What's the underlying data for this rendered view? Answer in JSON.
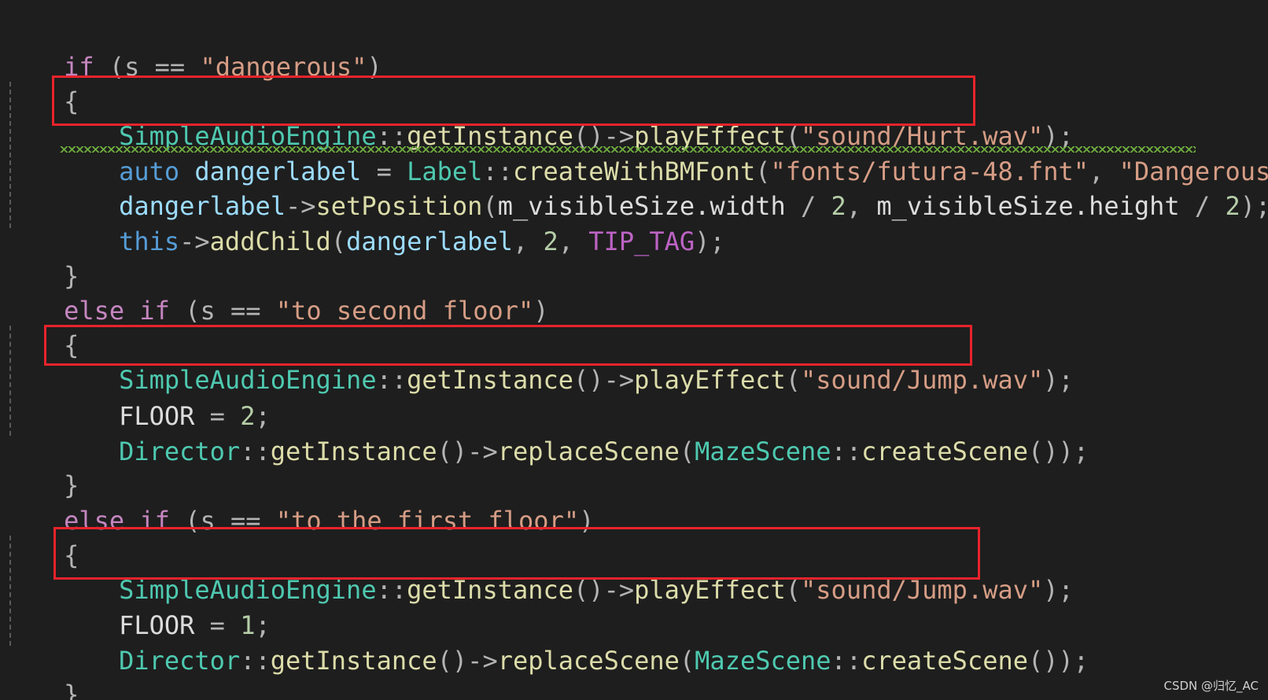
{
  "code": {
    "l1": {
      "kw": "if",
      "open": " (",
      "var": "s",
      "eq": " == ",
      "str": "\"dangerous\"",
      "close": ")"
    },
    "brace_open": "{",
    "brace_close": "}",
    "l3": {
      "cls": "SimpleAudioEngine",
      "sep": "::",
      "fn1": "getInstance",
      "call": "()",
      "arrow": "->",
      "fn2": "playEffect",
      "p1": "(",
      "str": "\"sound/Hurt.wav\"",
      "end": ");"
    },
    "l4": {
      "kw": "auto",
      "sp": " ",
      "var": "dangerlabel",
      "eq": " = ",
      "cls": "Label",
      "sep": "::",
      "fn": "createWithBMFont",
      "p1": "(",
      "str1": "\"fonts/futura-48.fnt\"",
      "comma": ", ",
      "str2": "\"Dangerous!\"",
      "end": ");"
    },
    "l5": {
      "var": "dangerlabel",
      "arrow": "->",
      "fn": "setPosition",
      "p1": "(",
      "arg1": "m_visibleSize.width",
      "div1": " / ",
      "n1": "2",
      "comma": ", ",
      "arg2": "m_visibleSize.height",
      "div2": " / ",
      "n2": "2",
      "end": ");"
    },
    "l6": {
      "kw": "this",
      "arrow": "->",
      "fn": "addChild",
      "p1": "(",
      "var": "dangerlabel",
      "c1": ", ",
      "n": "2",
      "c2": ", ",
      "macro": "TIP_TAG",
      "end": ");"
    },
    "l8": {
      "kw1": "else",
      "sp": " ",
      "kw2": "if",
      "open": " (",
      "var": "s",
      "eq": " == ",
      "str": "\"to second floor\"",
      "close": ")"
    },
    "l10": {
      "cls": "SimpleAudioEngine",
      "sep": "::",
      "fn1": "getInstance",
      "call": "()",
      "arrow": "->",
      "fn2": "playEffect",
      "p1": "(",
      "str": "\"sound/Jump.wav\"",
      "end": ");"
    },
    "l11": {
      "var": "FLOOR",
      "eq": " = ",
      "n": "2",
      "end": ";"
    },
    "l12": {
      "cls1": "Director",
      "sep1": "::",
      "fn1": "getInstance",
      "call1": "()",
      "arrow": "->",
      "fn2": "replaceScene",
      "p1": "(",
      "cls2": "MazeScene",
      "sep2": "::",
      "fn3": "createScene",
      "call2": "()",
      "end": ");"
    },
    "l14": {
      "kw1": "else",
      "sp": " ",
      "kw2": "if",
      "open": " (",
      "var": "s",
      "eq": " == ",
      "str": "\"to the first floor\"",
      "close": ")"
    },
    "l16": {
      "cls": "SimpleAudioEngine",
      "sep": "::",
      "fn1": "getInstance",
      "call": "()",
      "arrow": "->",
      "fn2": "playEffect",
      "p1": "(",
      "str": "\"sound/Jump.wav\"",
      "end": ");"
    },
    "l17": {
      "var": "FLOOR",
      "eq": " = ",
      "n": "1",
      "end": ";"
    },
    "l18": {
      "cls1": "Director",
      "sep1": "::",
      "fn1": "getInstance",
      "call1": "()",
      "arrow": "->",
      "fn2": "replaceScene",
      "p1": "(",
      "cls2": "MazeScene",
      "sep2": "::",
      "fn3": "createScene",
      "call2": "()",
      "end": ");"
    }
  },
  "watermark": "CSDN @归忆_AC",
  "colors": {
    "background": "#1e1e1e",
    "highlight_box": "#e8232b",
    "keyword": "#c586c0",
    "type": "#4ec9b0",
    "function": "#dcdcaa",
    "string": "#d69d85",
    "variable": "#9cdcfe",
    "squiggle": "#6fae3f"
  }
}
